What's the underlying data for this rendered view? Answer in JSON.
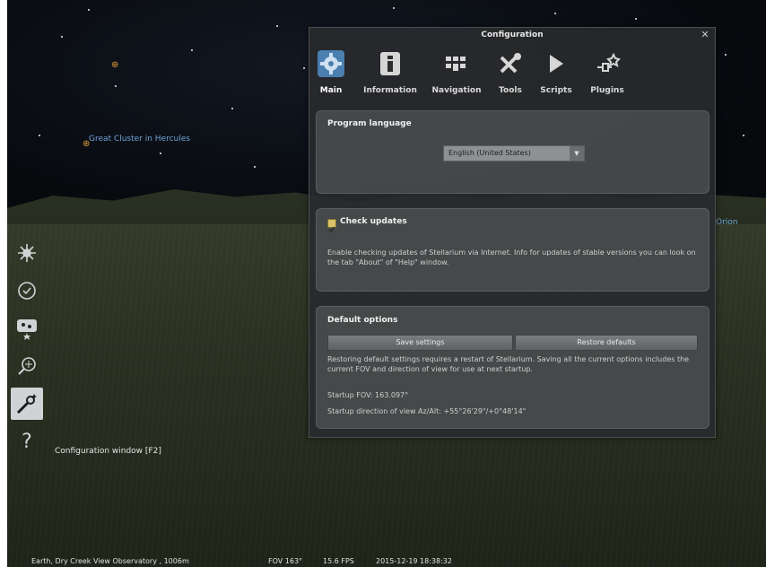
{
  "sky": {
    "labels": {
      "cluster": "Great Cluster in Hercules",
      "orion": "Orion"
    }
  },
  "sidebar": {
    "tooltip": "Configuration window  [F2]",
    "help_label": "?"
  },
  "status": {
    "location": "Earth, Dry Creek View Observatory , 1006m",
    "fov": "FOV 163°",
    "fps": "15.6 FPS",
    "datetime": "2015-12-19   18:38:32"
  },
  "window": {
    "title": "Configuration",
    "close": "✕",
    "tabs": [
      {
        "label": "Main",
        "icon": "gear-icon"
      },
      {
        "label": "Information",
        "icon": "info-icon"
      },
      {
        "label": "Navigation",
        "icon": "keyboard-icon"
      },
      {
        "label": "Tools",
        "icon": "tools-icon"
      },
      {
        "label": "Scripts",
        "icon": "play-icon"
      },
      {
        "label": "Plugins",
        "icon": "plugin-icon"
      }
    ],
    "language": {
      "title": "Program language",
      "selected": "English (United States)"
    },
    "updates": {
      "title": "Check updates",
      "checked": true,
      "description": "Enable checking updates of Stellarium via Internet. Info for updates of stable versions you can look on the tab \"About\" of \"Help\" window."
    },
    "defaults": {
      "title": "Default options",
      "save_label": "Save settings",
      "restore_label": "Restore defaults",
      "description": "Restoring default settings requires a restart of Stellarium. Saving all the current options includes the current FOV and direction of view for use at next startup.",
      "startup_fov": "Startup FOV: 163.097°",
      "startup_direction": "Startup direction of view Az/Alt: +55°26'29\"/+0°48'14\""
    }
  },
  "colors": {
    "window_bg": "#2a2c2e",
    "group_bg": "#5f6264",
    "accent_tab": "#4a7fb0",
    "label_blue": "#6fa3d8",
    "planet_orange": "#e09a3c"
  }
}
